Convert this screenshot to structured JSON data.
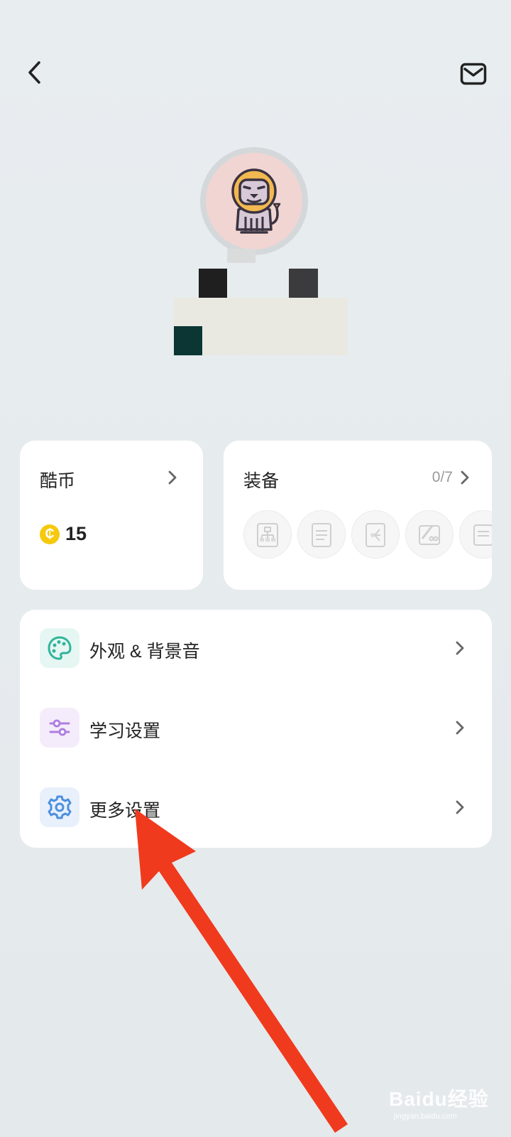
{
  "header": {
    "back_icon": "chevron-left-icon",
    "mail_icon": "mail-icon"
  },
  "profile": {
    "avatar_icon": "lion-avatar-icon"
  },
  "coins_card": {
    "title": "酷币",
    "value": "15",
    "coin_symbol": "₵",
    "coin_color": "#f6c90e"
  },
  "equip_card": {
    "title": "装备",
    "count": "0/7",
    "items": [
      "flowchart-icon",
      "notebook-icon",
      "mindmap-icon",
      "pencil-infinity-icon",
      "book-icon"
    ]
  },
  "settings": [
    {
      "label": "外观 & 背景音",
      "icon": "palette-icon",
      "bg": "#e6f6f2",
      "color": "#2fb59a"
    },
    {
      "label": "学习设置",
      "icon": "sliders-icon",
      "bg": "#f4ecfb",
      "color": "#b07ee0"
    },
    {
      "label": "更多设置",
      "icon": "gear-icon",
      "bg": "#e8f0fb",
      "color": "#4d8fe0"
    }
  ],
  "annotation": {
    "arrow_color": "#f03a1e"
  },
  "watermark": {
    "brand": "Baidu经验",
    "url": "jingyan.baidu.com"
  }
}
